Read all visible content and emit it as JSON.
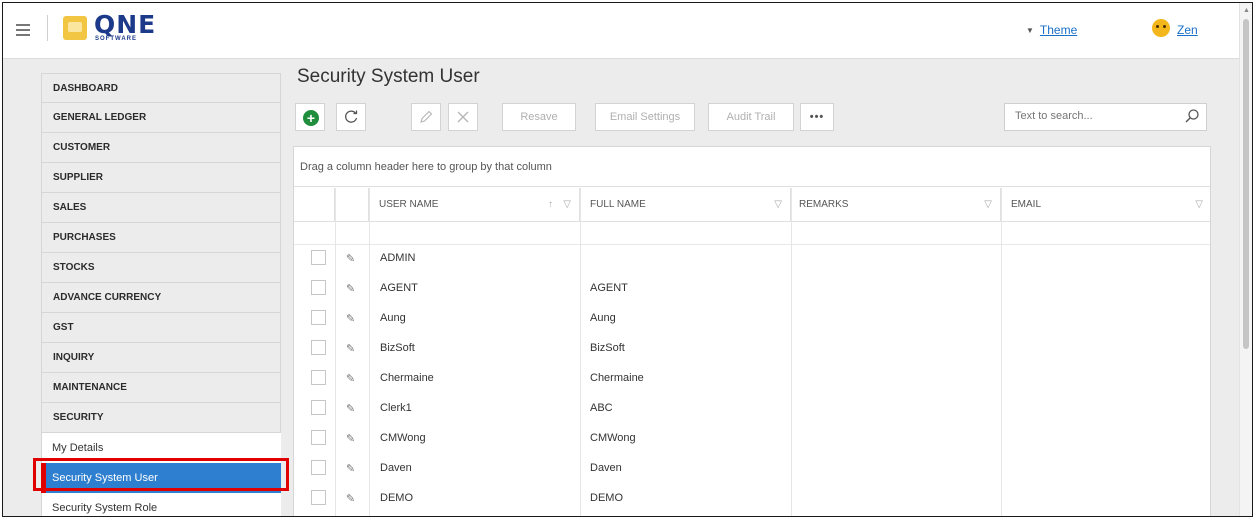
{
  "header": {
    "logo_text": "QNE",
    "logo_sub": "SOFTWARE",
    "theme_label": "Theme",
    "user_name": "Zen"
  },
  "sidebar": {
    "items": [
      {
        "label": "DASHBOARD"
      },
      {
        "label": "GENERAL LEDGER"
      },
      {
        "label": "CUSTOMER"
      },
      {
        "label": "SUPPLIER"
      },
      {
        "label": "SALES"
      },
      {
        "label": "PURCHASES"
      },
      {
        "label": "STOCKS"
      },
      {
        "label": "ADVANCE CURRENCY"
      },
      {
        "label": "GST"
      },
      {
        "label": "INQUIRY"
      },
      {
        "label": "MAINTENANCE"
      },
      {
        "label": "SECURITY"
      }
    ],
    "sub_items": [
      {
        "label": "My Details",
        "active": false
      },
      {
        "label": "Security System User",
        "active": true
      },
      {
        "label": "Security System Role",
        "active": false
      }
    ]
  },
  "page": {
    "title": "Security System User"
  },
  "toolbar": {
    "add_icon": "plus-circle-icon",
    "refresh_icon": "refresh-icon",
    "edit_icon": "pencil-icon",
    "delete_icon": "close-icon",
    "resave_label": "Resave",
    "email_settings_label": "Email Settings",
    "audit_trail_label": "Audit Trail",
    "more_label": "•••"
  },
  "search": {
    "placeholder": "Text to search..."
  },
  "grid": {
    "group_panel_text": "Drag a column header here to group by that column",
    "columns": [
      "USER NAME",
      "FULL NAME",
      "REMARKS",
      "EMAIL"
    ],
    "sort_column": "USER NAME",
    "sort_direction": "ascending",
    "rows": [
      {
        "user_name": "ADMIN",
        "full_name": ""
      },
      {
        "user_name": "AGENT",
        "full_name": "AGENT"
      },
      {
        "user_name": "Aung",
        "full_name": "Aung"
      },
      {
        "user_name": "BizSoft",
        "full_name": "BizSoft"
      },
      {
        "user_name": "Chermaine",
        "full_name": "Chermaine"
      },
      {
        "user_name": "Clerk1",
        "full_name": "ABC"
      },
      {
        "user_name": "CMWong",
        "full_name": "CMWong"
      },
      {
        "user_name": "Daven",
        "full_name": "Daven"
      },
      {
        "user_name": "DEMO",
        "full_name": "DEMO"
      }
    ]
  },
  "colors": {
    "accent": "#2e7fcf",
    "highlight": "#e00000",
    "add_button": "#1e8d3c",
    "link": "#1a6fc9"
  }
}
